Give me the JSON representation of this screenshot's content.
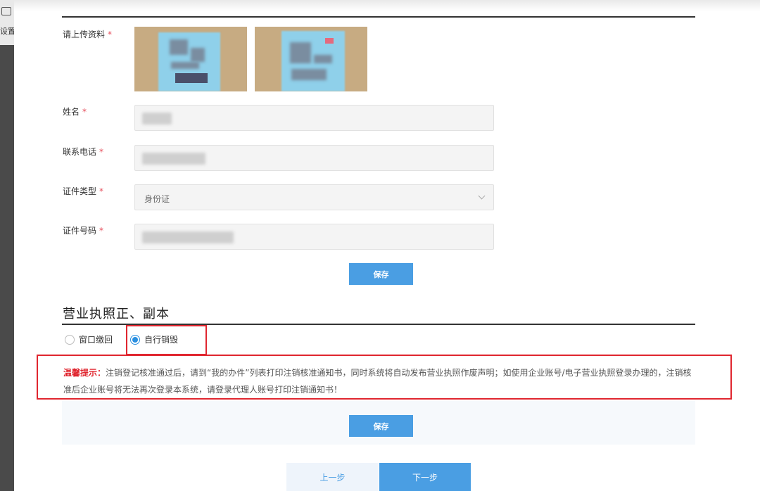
{
  "toolbar": {
    "label": "设置"
  },
  "upload": {
    "label": "请上传资料",
    "required_mark": "*"
  },
  "form": {
    "name": {
      "label": "姓名",
      "required_mark": "*"
    },
    "phone": {
      "label": "联系电话",
      "required_mark": "*"
    },
    "id_type": {
      "label": "证件类型",
      "required_mark": "*",
      "value": "身份证"
    },
    "id_number": {
      "label": "证件号码",
      "required_mark": "*"
    },
    "save_label": "保存"
  },
  "license": {
    "title": "营业执照正、副本",
    "options": [
      {
        "label": "窗口缴回",
        "checked": false
      },
      {
        "label": "自行销毁",
        "checked": true
      }
    ],
    "notice_tip": "温馨提示：",
    "notice_text": "注销登记核准通过后，请到“我的办件”列表打印注销核准通知书，同时系统将自动发布营业执照作废声明；如使用企业账号/电子营业执照登录办理的，注销核准后企业账号将无法再次登录本系统，请登录代理人账号打印注销通知书！",
    "save_label": "保存"
  },
  "nav": {
    "prev_label": "上一步",
    "next_label": "下一步"
  },
  "colors": {
    "primary": "#4a9ee3",
    "highlight": "#e0262f",
    "required": "#e6505d"
  }
}
